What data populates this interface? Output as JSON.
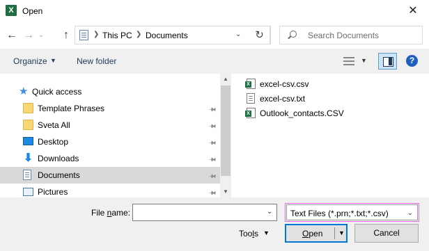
{
  "window": {
    "app_icon": "X",
    "title": "Open",
    "close_label": "✕"
  },
  "navigation": {
    "back_icon": "←",
    "forward_icon": "→",
    "recent_icon": "⌄",
    "up_icon": "↑",
    "breadcrumb": [
      "This PC",
      "Documents"
    ],
    "refresh_icon": "↻",
    "search_placeholder": "Search Documents"
  },
  "commandbar": {
    "organize": "Organize",
    "new_folder": "New folder",
    "help": "?"
  },
  "navpane": {
    "items": [
      {
        "label": "Quick access",
        "icon": "star-icon",
        "pinned": false,
        "selected": false
      },
      {
        "label": "Template Phrases",
        "icon": "folder-icon",
        "pinned": true,
        "selected": false
      },
      {
        "label": "Sveta All",
        "icon": "folder-icon",
        "pinned": true,
        "selected": false
      },
      {
        "label": "Desktop",
        "icon": "desktop-icon",
        "pinned": true,
        "selected": false
      },
      {
        "label": "Downloads",
        "icon": "downloads-icon",
        "pinned": true,
        "selected": false
      },
      {
        "label": "Documents",
        "icon": "documents-icon",
        "pinned": true,
        "selected": true
      },
      {
        "label": "Pictures",
        "icon": "pictures-icon",
        "pinned": true,
        "selected": false
      }
    ]
  },
  "files": [
    {
      "name": "excel-csv.csv",
      "icon": "excel-file-icon"
    },
    {
      "name": "excel-csv.txt",
      "icon": "txt-file-icon"
    },
    {
      "name": "Outlook_contacts.CSV",
      "icon": "excel-file-icon"
    }
  ],
  "bottom": {
    "file_name_label_pre": "File ",
    "file_name_label_ul": "n",
    "file_name_label_post": "ame:",
    "file_name_value": "",
    "file_type_selected": "Text Files (*.prn;*.txt;*.csv)",
    "tools_pre": "Too",
    "tools_ul": "l",
    "tools_post": "s",
    "open_ul": "O",
    "open_post": "pen",
    "cancel": "Cancel"
  }
}
